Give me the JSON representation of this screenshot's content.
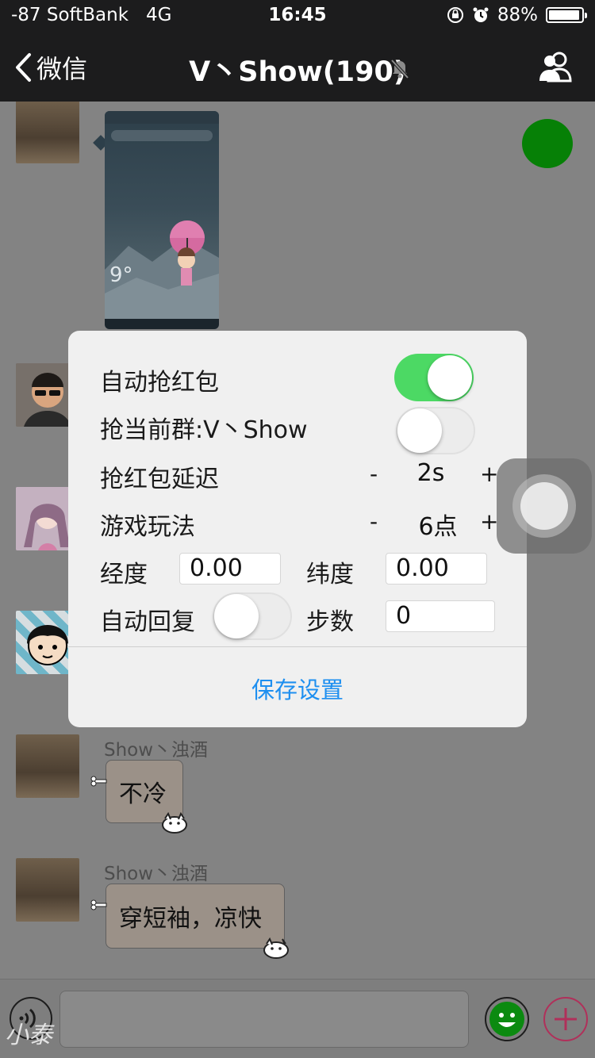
{
  "status_bar": {
    "carrier": "-87 SoftBank",
    "network": "4G",
    "time": "16:45",
    "battery_text": "88%",
    "battery_level": 0.88
  },
  "nav": {
    "back_label": "微信",
    "title": "V丶Show(190)",
    "icons": [
      "chevron-left-icon",
      "bell-slash-icon",
      "group-members-icon"
    ]
  },
  "messages": [
    {
      "sender": "Show丶浊酒",
      "type": "image"
    },
    {
      "sender": "",
      "type": "avatar-only"
    },
    {
      "sender": "",
      "type": "avatar-only"
    },
    {
      "sender": "",
      "type": "avatar-only"
    },
    {
      "sender": "Show丶浊酒",
      "text": "不冷"
    },
    {
      "sender": "Show丶浊酒",
      "text": "穿短袖，凉快"
    }
  ],
  "dialog": {
    "auto_grab_label": "自动抢红包",
    "auto_grab_on": true,
    "grab_current_label": "抢当前群:V丶Show",
    "grab_current_on": false,
    "delay_label": "抢红包延迟",
    "delay_value": "2s",
    "game_label": "游戏玩法",
    "game_value": "6点",
    "minus": "-",
    "plus": "+",
    "longitude_label": "经度",
    "longitude_value": "0.00",
    "latitude_label": "纬度",
    "latitude_value": "0.00",
    "auto_reply_label": "自动回复",
    "auto_reply_on": false,
    "steps_label": "步数",
    "steps_value": "0",
    "save_label": "保存设置"
  },
  "watermark": "小泰",
  "colors": {
    "switch_on": "#4cd964",
    "save_link": "#1e8ff0",
    "green_dot": "#068006",
    "plus_button": "#b0305a"
  }
}
